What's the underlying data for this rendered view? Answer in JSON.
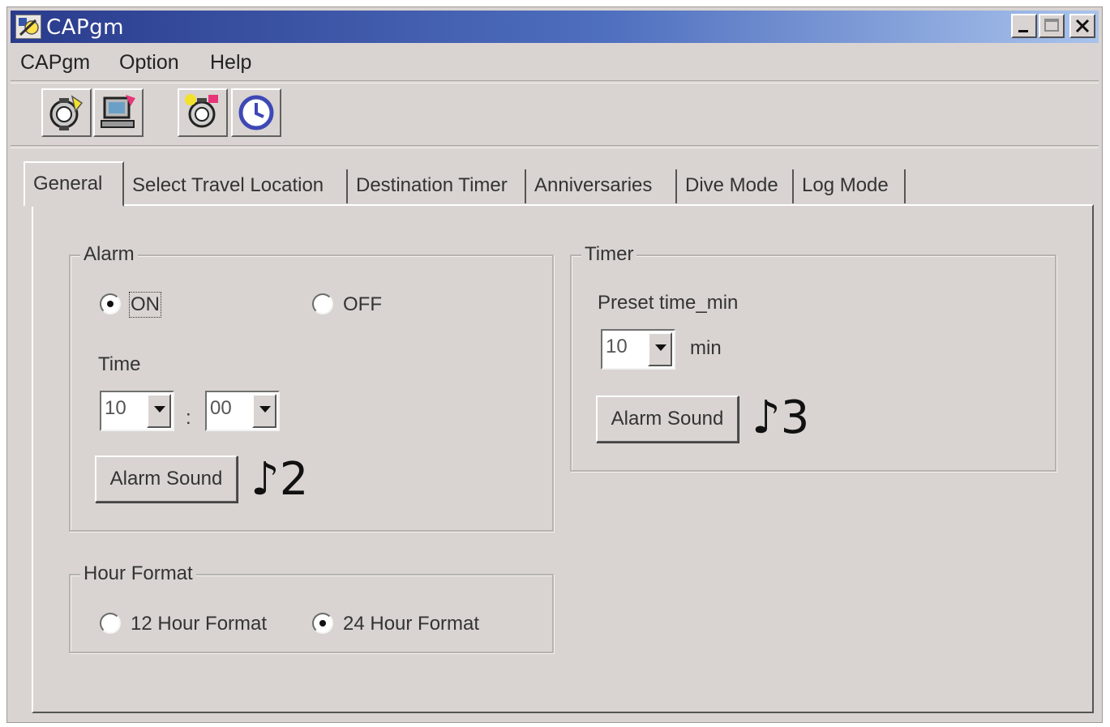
{
  "window": {
    "title": "CAPgm"
  },
  "menu": [
    {
      "label": "CAPgm",
      "underline": "C"
    },
    {
      "label": "Option",
      "underline": "O"
    },
    {
      "label": "Help",
      "underline": "H"
    }
  ],
  "toolbar_icons": [
    "watch-download-icon",
    "pc-upload-icon",
    "watch-settings-icon",
    "clock-icon"
  ],
  "tabs": [
    "General",
    "Select Travel Location",
    "Destination Timer",
    "Anniversaries",
    "Dive Mode",
    "Log Mode"
  ],
  "alarm": {
    "group_label": "Alarm",
    "on_label": "ON",
    "off_label": "OFF",
    "selected": "ON",
    "time_label": "Time",
    "hour": "10",
    "time_separator": ":",
    "minute": "00",
    "sound_button": "Alarm Sound",
    "sound_marker": "♪2"
  },
  "timer": {
    "group_label": "Timer",
    "preset_label": "Preset time_min",
    "preset_value": "10",
    "unit": "min",
    "sound_button": "Alarm Sound",
    "sound_marker": "♪3"
  },
  "hour_format": {
    "group_label": "Hour Format",
    "option_12": "12 Hour Format",
    "option_24": "24 Hour Format",
    "selected": "24 Hour Format"
  }
}
